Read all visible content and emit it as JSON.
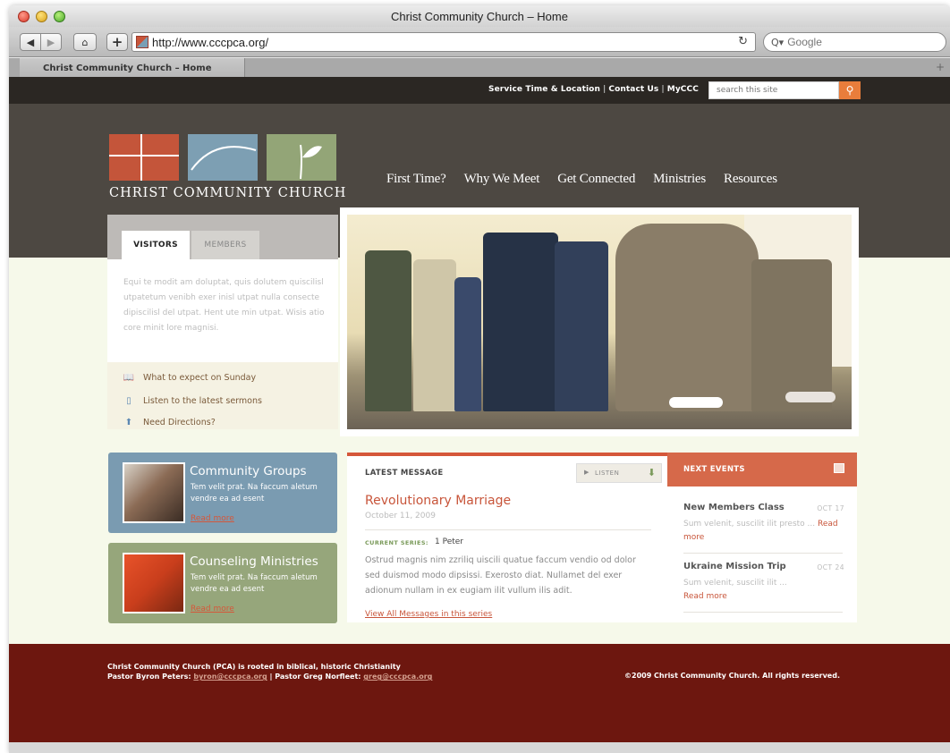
{
  "browser": {
    "window_title": "Christ Community Church – Home",
    "url": "http://www.cccpca.org/",
    "search_placeholder": "Google",
    "tab_title": "Christ Community Church – Home"
  },
  "utility_nav": {
    "links": [
      "Service Time & Location",
      "Contact Us",
      "MyCCC"
    ],
    "search_placeholder": "search this site"
  },
  "logo": {
    "text": "CHRIST COMMUNITY CHURCH"
  },
  "main_nav": [
    "First Time?",
    "Why We Meet",
    "Get Connected",
    "Ministries",
    "Resources"
  ],
  "visitor_panel": {
    "tabs": [
      "VISITORS",
      "MEMBERS"
    ],
    "text": "Equi te modit am doluptat, quis dolutem quiscilisl utpatetum venibh exer inisl utpat nulla consecte dipiscilisl del utpat. Hent ute min utpat. Wisis atio core minit lore magnisi.",
    "links": [
      "What to expect on Sunday",
      "Listen to the latest sermons",
      "Need Directions?"
    ]
  },
  "ministries": [
    {
      "title": "Community Groups",
      "text": "Tem velit prat. Na faccum aletum vendre ea ad esent",
      "more": "Read more"
    },
    {
      "title": "Counseling Ministries",
      "text": "Tem velit prat. Na faccum aletum vendre ea ad esent",
      "more": "Read more"
    }
  ],
  "latest_message": {
    "heading": "LATEST MESSAGE",
    "listen_label": "LISTEN",
    "title": "Revolutionary Marriage",
    "date": "October 11, 2009",
    "series_label": "CURRENT SERIES:",
    "series": "1 Peter",
    "body": "Ostrud magnis nim zzriliq uiscili quatue faccum vendio od dolor sed duismod modo dipsissi. Exerosto diat. Nullamet del exer adionum nullam in ex eugiam ilit vullum ilis adit.",
    "all_link": "View All Messages in this series"
  },
  "next_events": {
    "heading": "NEXT EVENTS",
    "items": [
      {
        "name": "New Members Class",
        "date": "OCT 17",
        "desc": "Sum velenit, suscilit ilit presto ...",
        "more": "Read more"
      },
      {
        "name": "Ukraine Mission Trip",
        "date": "OCT 24",
        "desc": "Sum velenit, suscilit ilit ...",
        "more": "Read more"
      }
    ]
  },
  "footer": {
    "line1": "Christ Community Church (PCA) is rooted in biblical, historic Christianity",
    "pastor1_label": "Pastor Byron Peters:",
    "pastor1_email": "byron@cccpca.org",
    "pastor2_label": "Pastor Greg Norfleet:",
    "pastor2_email": "greg@cccpca.org",
    "copyright": "©2009 Christ Community Church. All rights reserved."
  },
  "colors": {
    "header_bg": "#4d4842",
    "accent": "#c8553a",
    "blue": "#7d9fb3",
    "green": "#93a577",
    "footer_bg": "#6d170f",
    "page_bg": "#f6f9ea"
  }
}
